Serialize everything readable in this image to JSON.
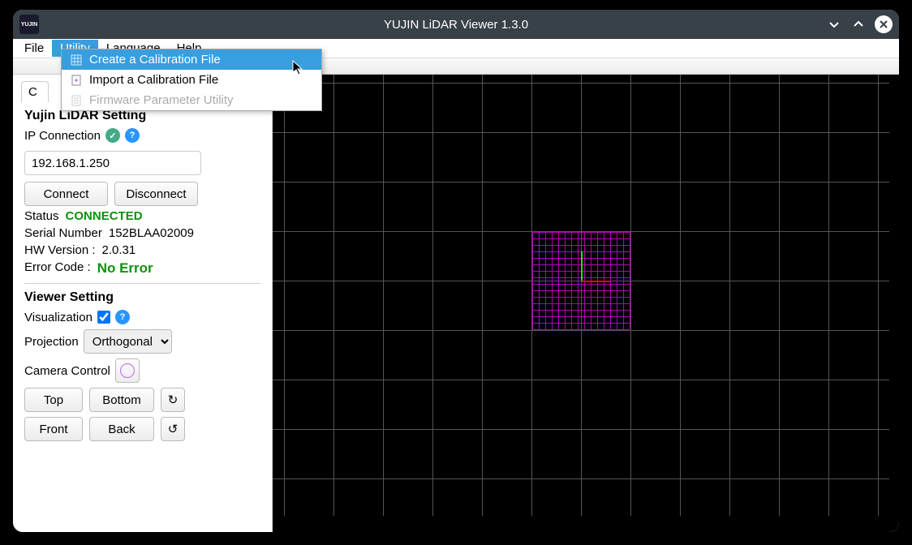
{
  "window": {
    "title": "YUJIN LiDAR Viewer 1.3.0",
    "logo_text": "YUJIN"
  },
  "menubar": {
    "file": "File",
    "utility": "Utility",
    "language": "Language",
    "help": "Help"
  },
  "utility_menu": {
    "create_calib": "Create a Calibration File",
    "import_calib": "Import a Calibration File",
    "firmware": "Firmware Parameter Utility"
  },
  "sidebar": {
    "tab_label": "C",
    "lidar_setting_title": "Yujin LiDAR Setting",
    "ip_connection_label": "IP Connection",
    "ip_value": "192.168.1.250",
    "connect_btn": "Connect",
    "disconnect_btn": "Disconnect",
    "status_label": "Status",
    "status_value": "CONNECTED",
    "serial_label": "Serial Number",
    "serial_value": "152BLAA02009",
    "hw_label": "HW Version :",
    "hw_value": "2.0.31",
    "error_label": "Error Code :",
    "error_value": "No Error",
    "viewer_setting_title": "Viewer Setting",
    "visualization_label": "Visualization",
    "visualization_checked": true,
    "projection_label": "Projection",
    "projection_value": "Orthogonal",
    "camera_control_label": "Camera Control",
    "top_btn": "Top",
    "bottom_btn": "Bottom",
    "front_btn": "Front",
    "back_btn": "Back"
  },
  "colors": {
    "accent": "#389ede",
    "connected": "#0b930b",
    "grid": "#555555",
    "magenta": "#b000b0"
  }
}
